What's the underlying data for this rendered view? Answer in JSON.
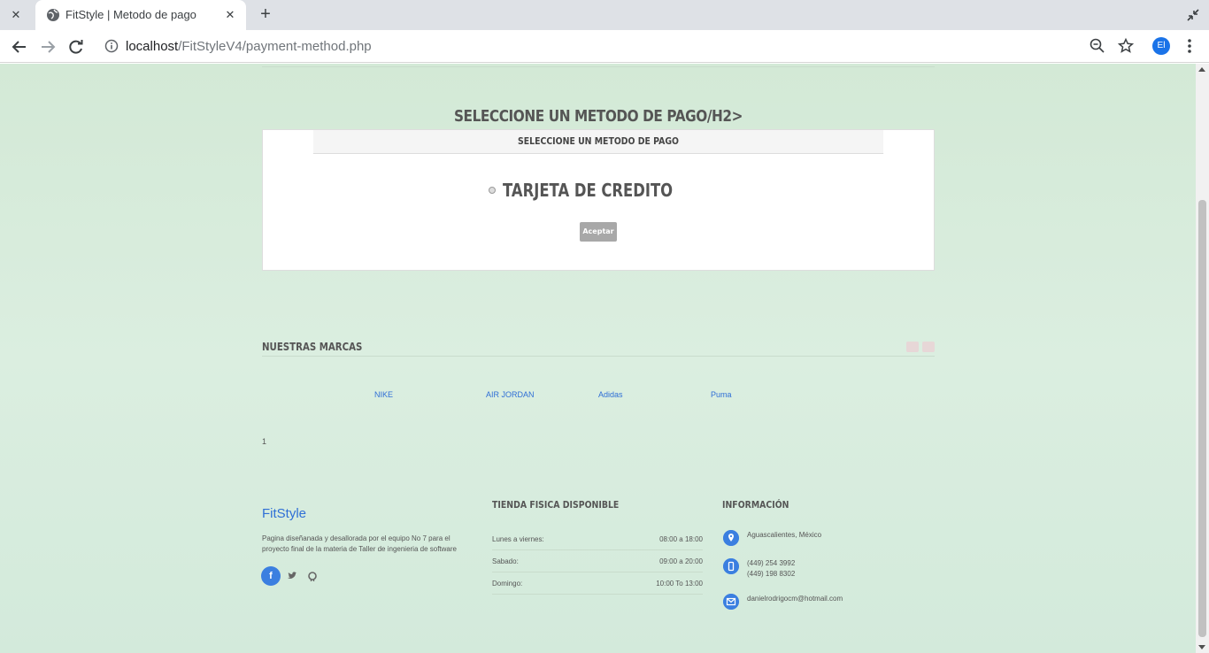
{
  "browser": {
    "tab_title": "FitStyle | Metodo de pago",
    "url_host": "localhost",
    "url_path": "/FitStyleV4/payment-method.php",
    "profile_initials": "El"
  },
  "page": {
    "main_heading": "SELECCIONE UN METODO DE PAGO/H2>",
    "panel_heading": "SELECCIONE UN METODO DE PAGO",
    "option_label": "TARJETA DE CREDITO",
    "accept_label": "Aceptar"
  },
  "brands": {
    "title": "NUESTRAS MARCAS",
    "items": [
      "NIKE",
      "AIR JORDAN",
      "Adidas",
      "Puma"
    ],
    "page_number": "1"
  },
  "footer": {
    "brand": "FitStyle",
    "description": "Pagina diseñanada y desallorada por el equipo No 7 para el proyecto final de la materia de Taller de ingenieria de software",
    "store_title": "TIENDA FISICA DISPONIBLE",
    "hours": [
      {
        "day": "Lunes a viernes:",
        "time": "08:00 a 18:00"
      },
      {
        "day": "Sabado:",
        "time": "09:00 a 20:00"
      },
      {
        "day": "Domingo:",
        "time": "10:00 To 13:00"
      }
    ],
    "info_title": "INFORMACIÓN",
    "location": "Aguascalientes, México",
    "phone_1": "(449) 254 3992",
    "phone_2": "(449) 198 8302",
    "email": "danielrodrigocm@hotmail.com"
  },
  "colors": {
    "accent": "#3b7fe0",
    "link": "#2f6fd6"
  }
}
